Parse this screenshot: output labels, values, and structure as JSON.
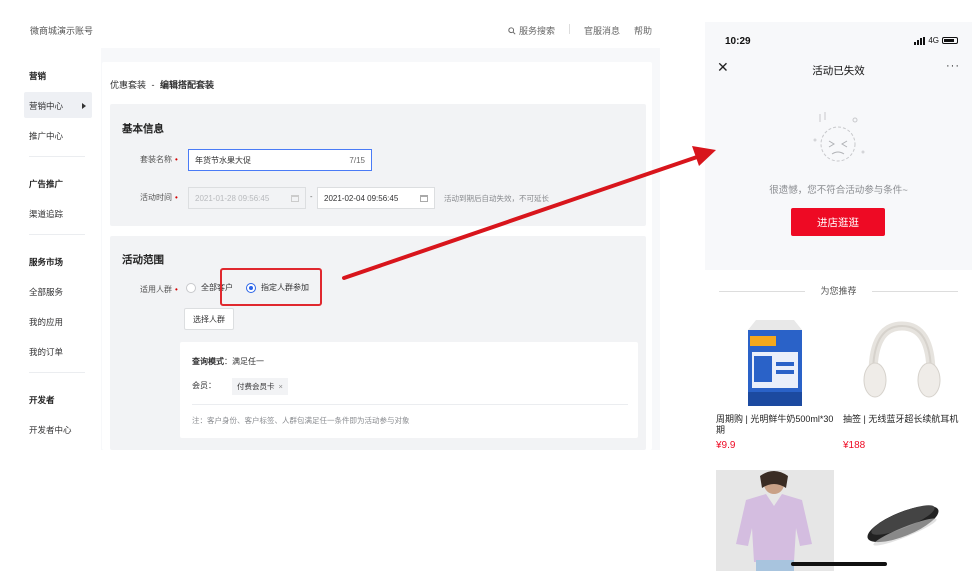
{
  "admin": {
    "topbar": {
      "shop_name": "微商城演示账号",
      "links": [
        "服务搜索",
        "官服消息",
        "帮助"
      ]
    },
    "sidebar": {
      "items": [
        {
          "label": "营销",
          "group": true
        },
        {
          "label": "营销中心",
          "active": true
        },
        {
          "label": "推广中心"
        },
        {
          "label": "广告推广",
          "group": true
        },
        {
          "label": "渠道追踪"
        },
        {
          "label": "服务市场",
          "group": true
        },
        {
          "label": "全部服务"
        },
        {
          "label": "我的应用"
        },
        {
          "label": "我的订单"
        },
        {
          "label": "开发者",
          "group": true
        },
        {
          "label": "开发者中心"
        }
      ]
    },
    "breadcrumb": {
      "parent": "优惠套装",
      "separator": "-",
      "current": "编辑搭配套装"
    },
    "basic_info": {
      "title": "基本信息",
      "name_label": "套装名称",
      "name_value": "年货节水果大促",
      "name_counter": "7/15",
      "time_label": "活动时间",
      "start_time": "2021-01-28 09:56:45",
      "end_time": "2021-02-04 09:56:45",
      "time_separator": "-",
      "time_hint": "活动到期后自动失效，不可延长"
    },
    "scope": {
      "title": "活动范围",
      "audience_label": "适用人群",
      "option_all": "全部客户",
      "option_specified": "指定人群参加",
      "selected": "option_specified",
      "select_button": "选择人群",
      "query_mode_label": "查询模式",
      "query_mode_value": "满足任一",
      "member_label": "会员",
      "member_tag": "付费会员卡",
      "note": "注：客户身份、客户标签、人群包满足任一条件即为活动参与对象"
    }
  },
  "phone": {
    "status_bar": {
      "time": "10:29",
      "network": "4G"
    },
    "nav": {
      "title": "活动已失效"
    },
    "empty_message": "很遗憾，您不符合活动参与条件~",
    "shop_button": "进店逛逛",
    "recommend_title": "为您推荐",
    "products": [
      {
        "name": "周期购 | 光明鲜牛奶500ml*30期",
        "price": "¥9.9"
      },
      {
        "name": "抽签 | 无线蓝牙超长续航耳机",
        "price": "¥188"
      },
      {
        "name": "",
        "price": ""
      },
      {
        "name": "",
        "price": ""
      }
    ]
  },
  "colors": {
    "accent_red": "#ee0a24",
    "highlight_red": "#e0282e",
    "primary_blue": "#2b64e8"
  },
  "icons": [
    "search-icon",
    "calendar-icon",
    "close-icon",
    "more-icon",
    "sad-face-icon",
    "signal-icon",
    "battery-icon"
  ]
}
